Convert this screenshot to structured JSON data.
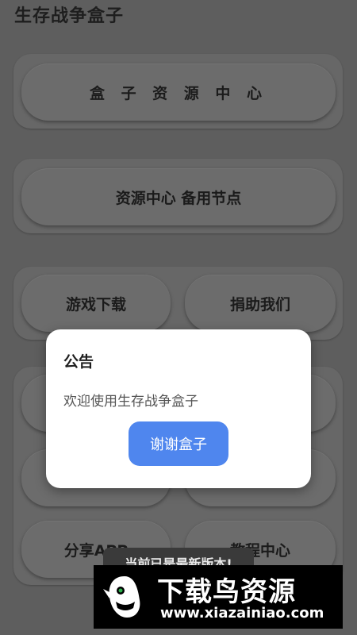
{
  "app": {
    "title": "生存战争盒子"
  },
  "buttons": {
    "resource_center": "盒 子 资 源 中 心",
    "backup_node": "资源中心 备用节点",
    "game_download": "游戏下载",
    "donate": "捐助我们",
    "share_app": "分享APP",
    "tutorial_center": "教程中心"
  },
  "dialog": {
    "title": "公告",
    "message": "欢迎使用生存战争盒子",
    "confirm_label": "谢谢盒子"
  },
  "toast": {
    "text": "当前已是最新版本!"
  },
  "watermark": {
    "name": "下载鸟资源",
    "url": "www.xiazainiao.com"
  },
  "colors": {
    "dialog_button": "#4f86ee",
    "scrim": "#5e5e5e"
  }
}
